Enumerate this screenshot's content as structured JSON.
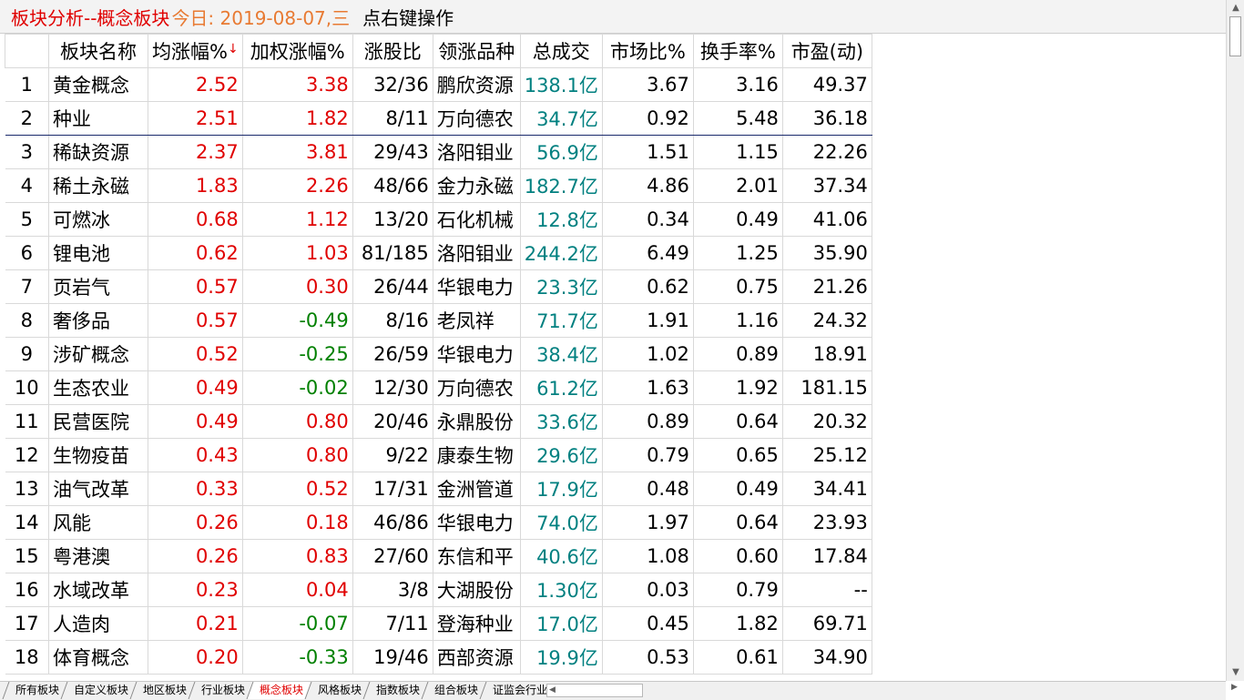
{
  "title": {
    "main": "板块分析--概念板块",
    "date": "今日: 2019-08-07,三",
    "hint": "点右键操作"
  },
  "columns": {
    "name": "板块名称",
    "avg": "均涨幅%",
    "avg_sort": "↓",
    "weighted": "加权涨幅%",
    "ratio": "涨股比",
    "lead": "领涨品种",
    "amount": "总成交",
    "market": "市场比%",
    "turnover": "换手率%",
    "pe": "市盈(动)"
  },
  "rows": [
    {
      "idx": "1",
      "name": "黄金概念",
      "avg": "2.52",
      "weighted": "3.38",
      "ratio": "32/36",
      "lead": "鹏欣资源",
      "amount": "138.1亿",
      "market": "3.67",
      "turnover": "3.16",
      "pe": "49.37",
      "w_dir": "up"
    },
    {
      "idx": "2",
      "name": "种业",
      "avg": "2.51",
      "weighted": "1.82",
      "ratio": "8/11",
      "lead": "万向德农",
      "amount": "34.7亿",
      "market": "0.92",
      "turnover": "5.48",
      "pe": "36.18",
      "w_dir": "up"
    },
    {
      "idx": "3",
      "name": "稀缺资源",
      "avg": "2.37",
      "weighted": "3.81",
      "ratio": "29/43",
      "lead": "洛阳钼业",
      "amount": "56.9亿",
      "market": "1.51",
      "turnover": "1.15",
      "pe": "22.26",
      "w_dir": "up"
    },
    {
      "idx": "4",
      "name": "稀土永磁",
      "avg": "1.83",
      "weighted": "2.26",
      "ratio": "48/66",
      "lead": "金力永磁",
      "amount": "182.7亿",
      "market": "4.86",
      "turnover": "2.01",
      "pe": "37.34",
      "w_dir": "up"
    },
    {
      "idx": "5",
      "name": "可燃冰",
      "avg": "0.68",
      "weighted": "1.12",
      "ratio": "13/20",
      "lead": "石化机械",
      "amount": "12.8亿",
      "market": "0.34",
      "turnover": "0.49",
      "pe": "41.06",
      "w_dir": "up"
    },
    {
      "idx": "6",
      "name": "锂电池",
      "avg": "0.62",
      "weighted": "1.03",
      "ratio": "81/185",
      "lead": "洛阳钼业",
      "amount": "244.2亿",
      "market": "6.49",
      "turnover": "1.25",
      "pe": "35.90",
      "w_dir": "up"
    },
    {
      "idx": "7",
      "name": "页岩气",
      "avg": "0.57",
      "weighted": "0.30",
      "ratio": "26/44",
      "lead": "华银电力",
      "amount": "23.3亿",
      "market": "0.62",
      "turnover": "0.75",
      "pe": "21.26",
      "w_dir": "up"
    },
    {
      "idx": "8",
      "name": "奢侈品",
      "avg": "0.57",
      "weighted": "-0.49",
      "ratio": "8/16",
      "lead": "老凤祥",
      "amount": "71.7亿",
      "market": "1.91",
      "turnover": "1.16",
      "pe": "24.32",
      "w_dir": "down"
    },
    {
      "idx": "9",
      "name": "涉矿概念",
      "avg": "0.52",
      "weighted": "-0.25",
      "ratio": "26/59",
      "lead": "华银电力",
      "amount": "38.4亿",
      "market": "1.02",
      "turnover": "0.89",
      "pe": "18.91",
      "w_dir": "down"
    },
    {
      "idx": "10",
      "name": "生态农业",
      "avg": "0.49",
      "weighted": "-0.02",
      "ratio": "12/30",
      "lead": "万向德农",
      "amount": "61.2亿",
      "market": "1.63",
      "turnover": "1.92",
      "pe": "181.15",
      "w_dir": "down"
    },
    {
      "idx": "11",
      "name": "民营医院",
      "avg": "0.49",
      "weighted": "0.80",
      "ratio": "20/46",
      "lead": "永鼎股份",
      "amount": "33.6亿",
      "market": "0.89",
      "turnover": "0.64",
      "pe": "20.32",
      "w_dir": "up"
    },
    {
      "idx": "12",
      "name": "生物疫苗",
      "avg": "0.43",
      "weighted": "0.80",
      "ratio": "9/22",
      "lead": "康泰生物",
      "amount": "29.6亿",
      "market": "0.79",
      "turnover": "0.65",
      "pe": "25.12",
      "w_dir": "up"
    },
    {
      "idx": "13",
      "name": "油气改革",
      "avg": "0.33",
      "weighted": "0.52",
      "ratio": "17/31",
      "lead": "金洲管道",
      "amount": "17.9亿",
      "market": "0.48",
      "turnover": "0.49",
      "pe": "34.41",
      "w_dir": "up"
    },
    {
      "idx": "14",
      "name": "风能",
      "avg": "0.26",
      "weighted": "0.18",
      "ratio": "46/86",
      "lead": "华银电力",
      "amount": "74.0亿",
      "market": "1.97",
      "turnover": "0.64",
      "pe": "23.93",
      "w_dir": "up"
    },
    {
      "idx": "15",
      "name": "粤港澳",
      "avg": "0.26",
      "weighted": "0.83",
      "ratio": "27/60",
      "lead": "东信和平",
      "amount": "40.6亿",
      "market": "1.08",
      "turnover": "0.60",
      "pe": "17.84",
      "w_dir": "up"
    },
    {
      "idx": "16",
      "name": "水域改革",
      "avg": "0.23",
      "weighted": "0.04",
      "ratio": "3/8",
      "lead": "大湖股份",
      "amount": "1.30亿",
      "market": "0.03",
      "turnover": "0.79",
      "pe": "--",
      "w_dir": "up"
    },
    {
      "idx": "17",
      "name": "人造肉",
      "avg": "0.21",
      "weighted": "-0.07",
      "ratio": "7/11",
      "lead": "登海种业",
      "amount": "17.0亿",
      "market": "0.45",
      "turnover": "1.82",
      "pe": "69.71",
      "w_dir": "down"
    },
    {
      "idx": "18",
      "name": "体育概念",
      "avg": "0.20",
      "weighted": "-0.33",
      "ratio": "19/46",
      "lead": "西部资源",
      "amount": "19.9亿",
      "market": "0.53",
      "turnover": "0.61",
      "pe": "34.90",
      "w_dir": "down"
    }
  ],
  "tabs": [
    {
      "label": "所有板块",
      "active": false
    },
    {
      "label": "自定义板块",
      "active": false
    },
    {
      "label": "地区板块",
      "active": false
    },
    {
      "label": "行业板块",
      "active": false
    },
    {
      "label": "概念板块",
      "active": true
    },
    {
      "label": "风格板块",
      "active": false
    },
    {
      "label": "指数板块",
      "active": false
    },
    {
      "label": "组合板块",
      "active": false
    },
    {
      "label": "证监会行业",
      "active": false
    }
  ],
  "icons": {
    "scroll_up": "▲",
    "scroll_down": "▼",
    "scroll_left": "◀",
    "scroll_right": "▶"
  },
  "colors": {
    "title_red": "#e00000",
    "date_orange": "#e87a32",
    "up_red": "#e00000",
    "down_green": "#008000",
    "amount_teal": "#008080"
  }
}
